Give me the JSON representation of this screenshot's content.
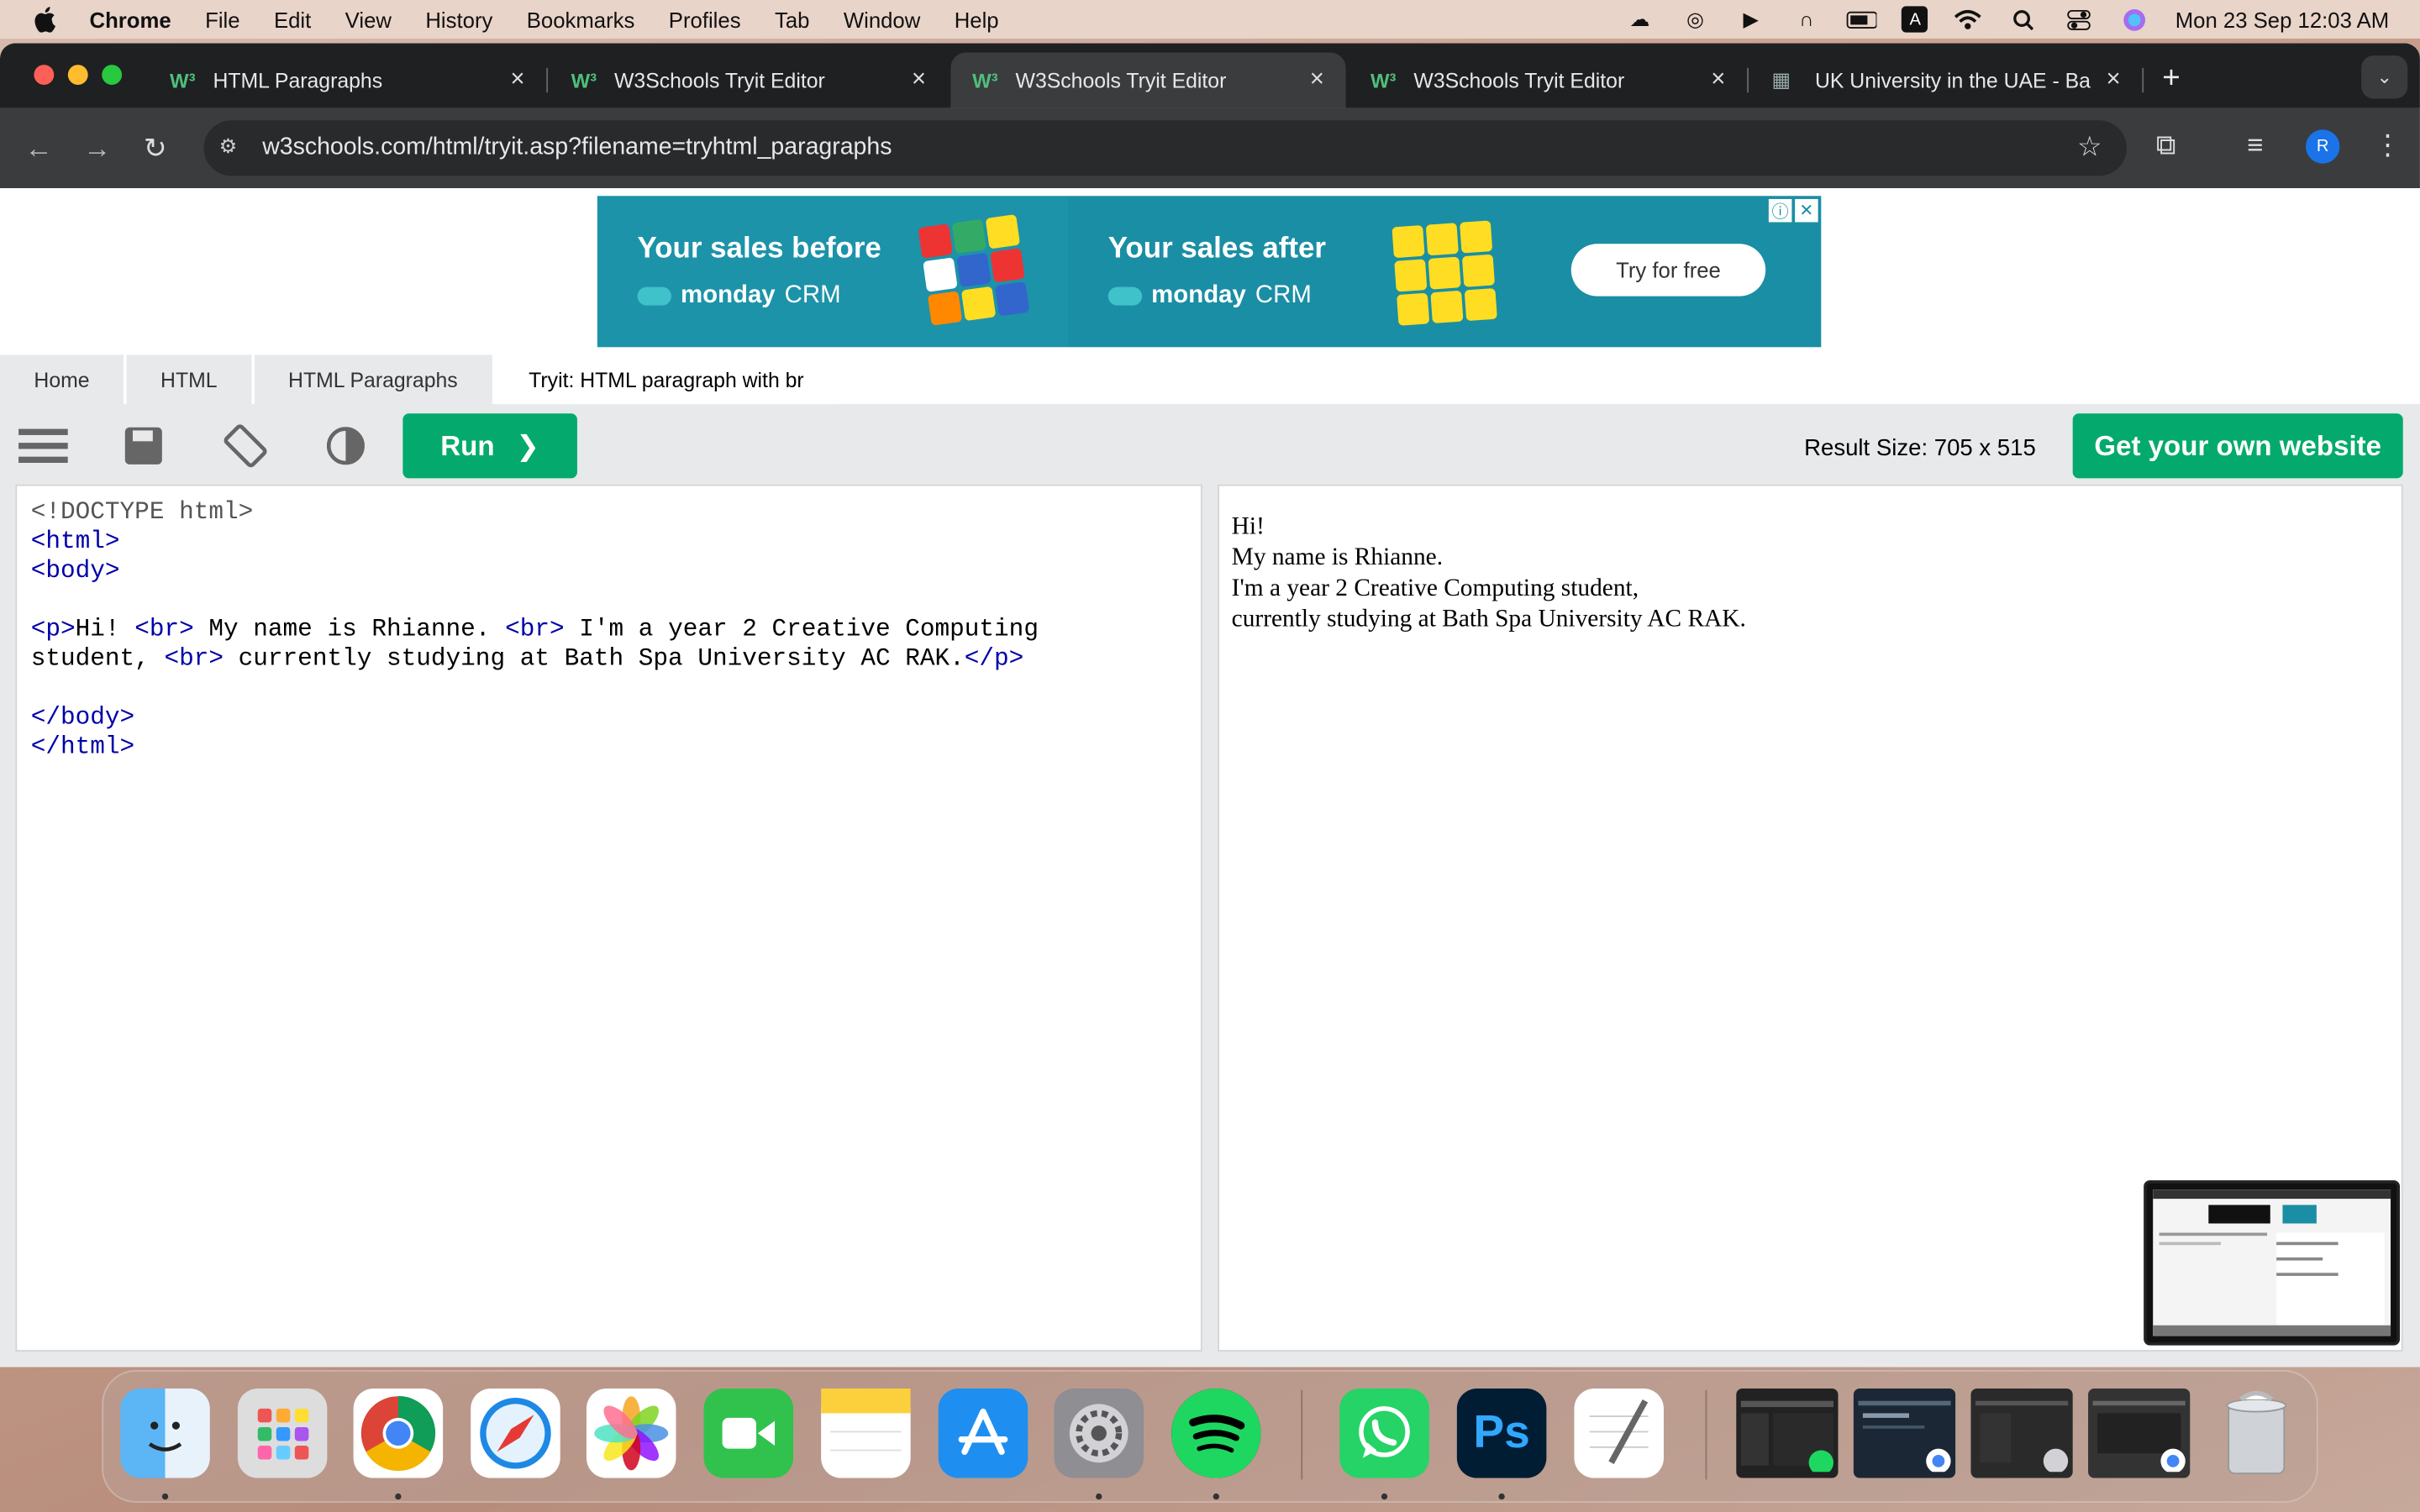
{
  "menubar": {
    "app": "Chrome",
    "items": [
      "File",
      "Edit",
      "View",
      "History",
      "Bookmarks",
      "Profiles",
      "Tab",
      "Window",
      "Help"
    ],
    "clock": "Mon 23 Sep  12:03 AM",
    "input_source": "A"
  },
  "tabs": [
    {
      "title": "HTML Paragraphs"
    },
    {
      "title": "W3Schools Tryit Editor"
    },
    {
      "title": "W3Schools Tryit Editor"
    },
    {
      "title": "W3Schools Tryit Editor"
    },
    {
      "title": "UK University in the UAE - Ba"
    }
  ],
  "active_tab_index": 2,
  "address": "w3schools.com/html/tryit.asp?filename=tryhtml_paragraphs",
  "profile_initial": "R",
  "ad": {
    "before_heading": "Your sales before",
    "after_heading": "Your sales after",
    "brand_bold": "monday",
    "brand_rest": "CRM",
    "cta": "Try for free"
  },
  "breadcrumb": [
    "Home",
    "HTML",
    "HTML Paragraphs",
    "Tryit: HTML paragraph with br"
  ],
  "editor_toolbar": {
    "run_label": "Run",
    "result_size": "Result Size: 705 x 515",
    "get_website": "Get your own website"
  },
  "code": {
    "doctype": "<!DOCTYPE html>",
    "l_html_open": "<html>",
    "l_body_open": "<body>",
    "p_open": "<p>",
    "t1": "Hi! ",
    "br": "<br>",
    "t2": " My name is Rhianne. ",
    "t3": " I'm a year 2 Creative Computing",
    "t4": "student, ",
    "t5": " currently studying at Bath Spa University AC RAK.",
    "p_close": "</p>",
    "l_body_close": "</body>",
    "l_html_close": "</html>"
  },
  "result_lines": [
    "Hi!",
    "My name is Rhianne.",
    "I'm a year 2 Creative Computing student,",
    "currently studying at Bath Spa University AC RAK."
  ],
  "dock": {
    "ps_label": "Ps"
  }
}
